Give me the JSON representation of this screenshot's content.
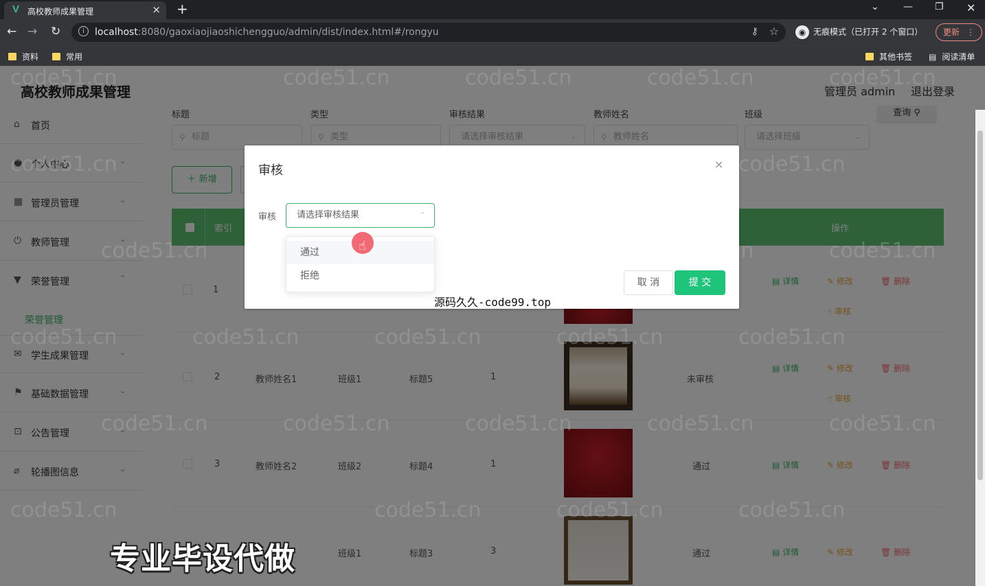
{
  "browser": {
    "tab_title": "高校教师成果管理",
    "tab_close": "×",
    "new_tab": "+",
    "url_host": "localhost",
    "url_rest": ":8080/gaoxiaojiaoshichengguo/admin/dist/index.html#/rongyu",
    "incognito": "无痕模式（已打开 2 个窗口）",
    "update": "更新",
    "bookmarks": [
      "资料",
      "常用"
    ],
    "other_bookmarks": "其他书签",
    "reading_list": "阅读清单"
  },
  "app": {
    "name": "高校教师成果管理",
    "user": "管理员 admin",
    "logout": "退出登录"
  },
  "sidebar": {
    "items": [
      {
        "label": "首页",
        "icon": "home-icon"
      },
      {
        "label": "个人中心",
        "icon": "user-icon"
      },
      {
        "label": "管理员管理",
        "icon": "grid-icon"
      },
      {
        "label": "教师管理",
        "icon": "power-icon"
      },
      {
        "label": "荣誉管理",
        "icon": "trophy-icon"
      },
      {
        "label": "学生成果管理",
        "icon": "mail-icon"
      },
      {
        "label": "基础数据管理",
        "icon": "flag-icon"
      },
      {
        "label": "公告管理",
        "icon": "frame-icon"
      },
      {
        "label": "轮播图信息",
        "icon": "pin-icon"
      }
    ],
    "sub_item": "荣誉管理"
  },
  "filters": {
    "labels": [
      "标题",
      "类型",
      "审核结果",
      "教师姓名",
      "班级"
    ],
    "placeholders": [
      "标题",
      "类型",
      "请选择审核结果",
      "教师姓名",
      "请选择班级"
    ],
    "search_button": "查询",
    "add_button": "新增"
  },
  "table": {
    "header_index": "索引",
    "header_ops": "操作",
    "rows": [
      {
        "index": "1",
        "teacher": "",
        "class": "",
        "title": "",
        "type": "",
        "status": ""
      },
      {
        "index": "2",
        "teacher": "教师姓名1",
        "class": "班级1",
        "title": "标题5",
        "type": "1",
        "status": "未审核"
      },
      {
        "index": "3",
        "teacher": "教师姓名2",
        "class": "班级2",
        "title": "标题4",
        "type": "1",
        "status": "通过"
      },
      {
        "index": "",
        "teacher": "",
        "class": "班级1",
        "title": "标题3",
        "type": "3",
        "status": "通过"
      }
    ],
    "action_detail": "详情",
    "action_edit": "修改",
    "action_delete": "删除",
    "action_review": "审核"
  },
  "dialog": {
    "title": "审核",
    "close": "×",
    "field_label": "审核",
    "select_placeholder": "请选择审核结果",
    "options": [
      "通过",
      "拒绝"
    ],
    "cancel": "取 消",
    "submit": "提 交"
  },
  "overlay": {
    "caption": "源码久久-code99.top",
    "banner": "专业毕设代做",
    "watermark": "code51.cn"
  }
}
